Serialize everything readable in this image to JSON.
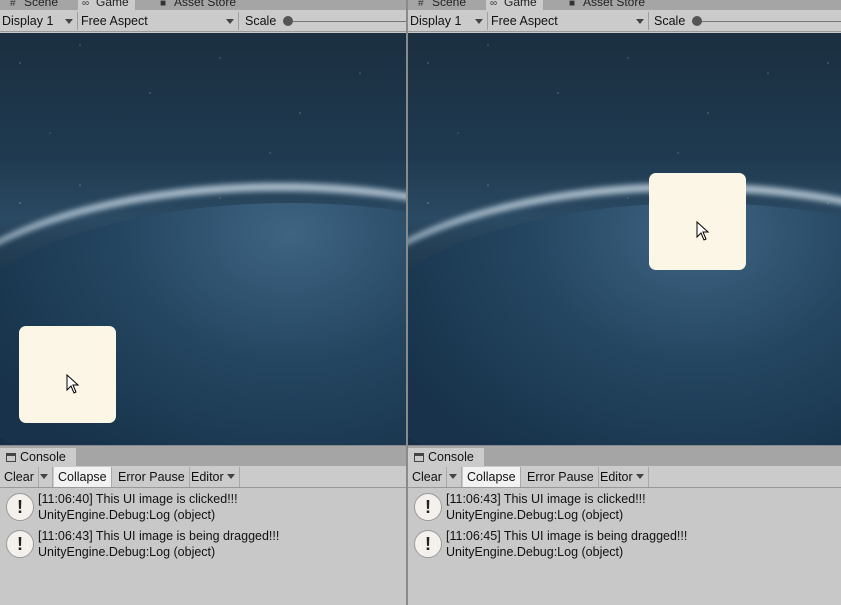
{
  "tabs": [
    "Scene",
    "Game",
    "Asset Store"
  ],
  "tab_icons": [
    "grid-icon",
    "gamepad-icon",
    "store-icon"
  ],
  "toolbar": {
    "display": "Display 1",
    "aspect": "Free Aspect",
    "scale_label": "Scale"
  },
  "console": {
    "tab_label": "Console",
    "buttons": {
      "clear": "Clear",
      "collapse": "Collapse",
      "error_pause": "Error Pause",
      "editor": "Editor"
    }
  },
  "left": {
    "logs": [
      {
        "message": "[11:06:40] This UI image is clicked!!!",
        "source": "UnityEngine.Debug:Log (object)"
      },
      {
        "message": "[11:06:43] This UI image is being dragged!!!",
        "source": "UnityEngine.Debug:Log (object)"
      }
    ]
  },
  "right": {
    "logs": [
      {
        "message": "[11:06:43] This UI image is clicked!!!",
        "source": "UnityEngine.Debug:Log (object)"
      },
      {
        "message": "[11:06:45] This UI image is being dragged!!!",
        "source": "UnityEngine.Debug:Log (object)"
      }
    ]
  },
  "colors": {
    "ui_image": "#fbf6e6",
    "panel_bg": "#c8c8c8",
    "tabbar_bg": "#a5a5a5"
  }
}
